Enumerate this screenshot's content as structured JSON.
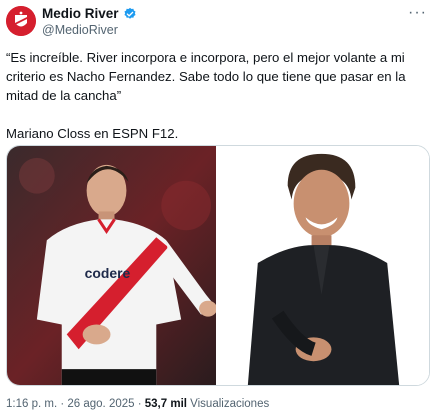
{
  "author": {
    "name": "Medio River",
    "handle": "@MedioRiver",
    "verified_color": "#1d9bf0"
  },
  "more_label": "···",
  "tweet": {
    "text": "“Es increíble. River incorpora e incorpora, pero el mejor volante a mi criterio es Nacho Fernandez. Sabe todo lo que tiene que pasar en la mitad de la cancha”\n\nMariano Closs en ESPN F12."
  },
  "media": {
    "left_shirt_text": "codere"
  },
  "meta": {
    "time": "1:16 p. m.",
    "sep1": " · ",
    "date": "26 ago. 2025",
    "sep2": " · ",
    "views_count": "53,7 mil",
    "views_label": " Visualizaciones"
  },
  "colors": {
    "brand_red": "#d51f2e",
    "text_primary": "#0f1419",
    "text_secondary": "#536471"
  }
}
